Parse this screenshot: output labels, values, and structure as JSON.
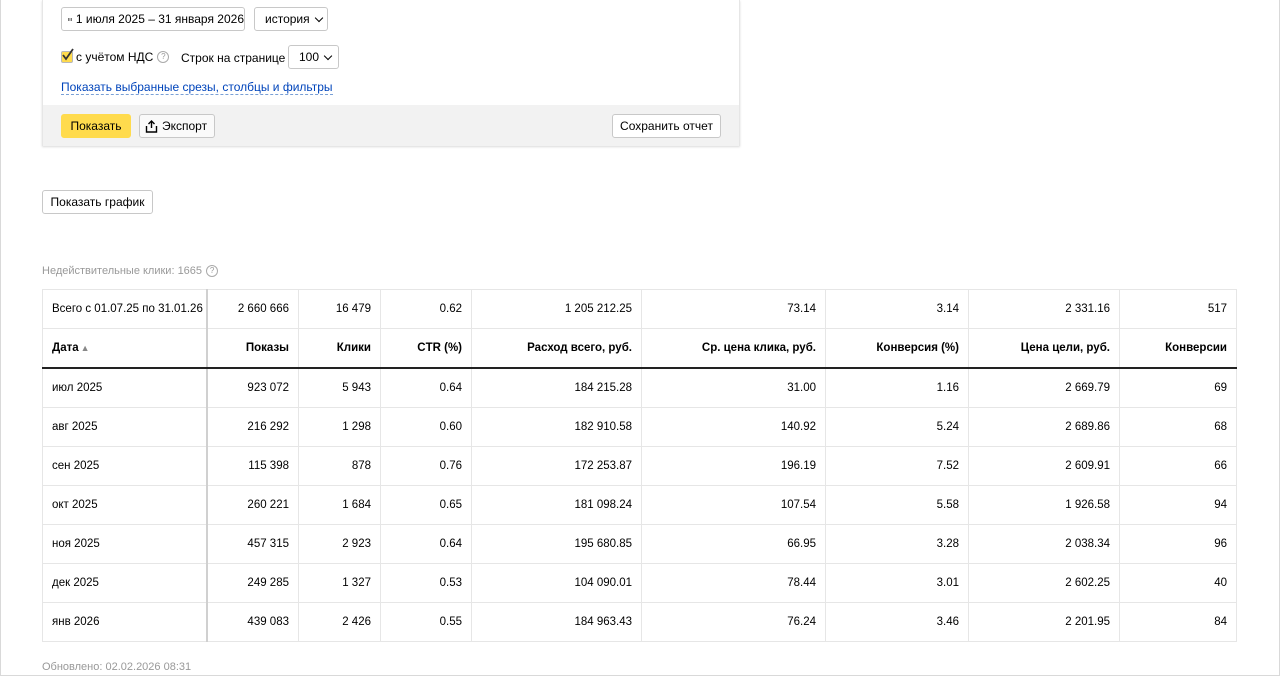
{
  "filters": {
    "date_range": "1 июля 2025 – 31 января 2026",
    "history": "история",
    "vat_label": "с учётом НДС",
    "vat_checked": true,
    "rows_label": "Строк на странице",
    "rows_value": "100",
    "show_selected_link": "Показать выбранные срезы, столбцы и фильтры",
    "show_button": "Показать",
    "export_button": "Экспорт",
    "save_report_button": "Сохранить отчет"
  },
  "show_chart_button": "Показать график",
  "invalid_clicks": "Недействительные клики: 1665",
  "table": {
    "total": [
      "Всего с 01.07.25 по 31.01.26",
      "2 660 666",
      "16 479",
      "0.62",
      "1 205 212.25",
      "73.14",
      "3.14",
      "2 331.16",
      "517"
    ],
    "headers": [
      "Дата",
      "Показы",
      "Клики",
      "CTR (%)",
      "Расход всего, руб.",
      "Ср. цена клика, руб.",
      "Конверсия (%)",
      "Цена цели, руб.",
      "Конверсии"
    ],
    "sort_indicator": "▲",
    "rows": [
      [
        "июл 2025",
        "923 072",
        "5 943",
        "0.64",
        "184 215.28",
        "31.00",
        "1.16",
        "2 669.79",
        "69"
      ],
      [
        "авг 2025",
        "216 292",
        "1 298",
        "0.60",
        "182 910.58",
        "140.92",
        "5.24",
        "2 689.86",
        "68"
      ],
      [
        "сен 2025",
        "115 398",
        "878",
        "0.76",
        "172 253.87",
        "196.19",
        "7.52",
        "2 609.91",
        "66"
      ],
      [
        "окт 2025",
        "260 221",
        "1 684",
        "0.65",
        "181 098.24",
        "107.54",
        "5.58",
        "1 926.58",
        "94"
      ],
      [
        "ноя 2025",
        "457 315",
        "2 923",
        "0.64",
        "195 680.85",
        "66.95",
        "3.28",
        "2 038.34",
        "96"
      ],
      [
        "дек 2025",
        "249 285",
        "1 327",
        "0.53",
        "104 090.01",
        "78.44",
        "3.01",
        "2 602.25",
        "40"
      ],
      [
        "янв 2026",
        "439 083",
        "2 426",
        "0.55",
        "184 963.43",
        "76.24",
        "3.46",
        "2 201.95",
        "84"
      ]
    ]
  },
  "updated": "Обновлено: 02.02.2026 08:31",
  "colors": {
    "accent_yellow": "#ffdb4d",
    "link_blue": "#0044bb",
    "muted_gray": "#999999"
  }
}
